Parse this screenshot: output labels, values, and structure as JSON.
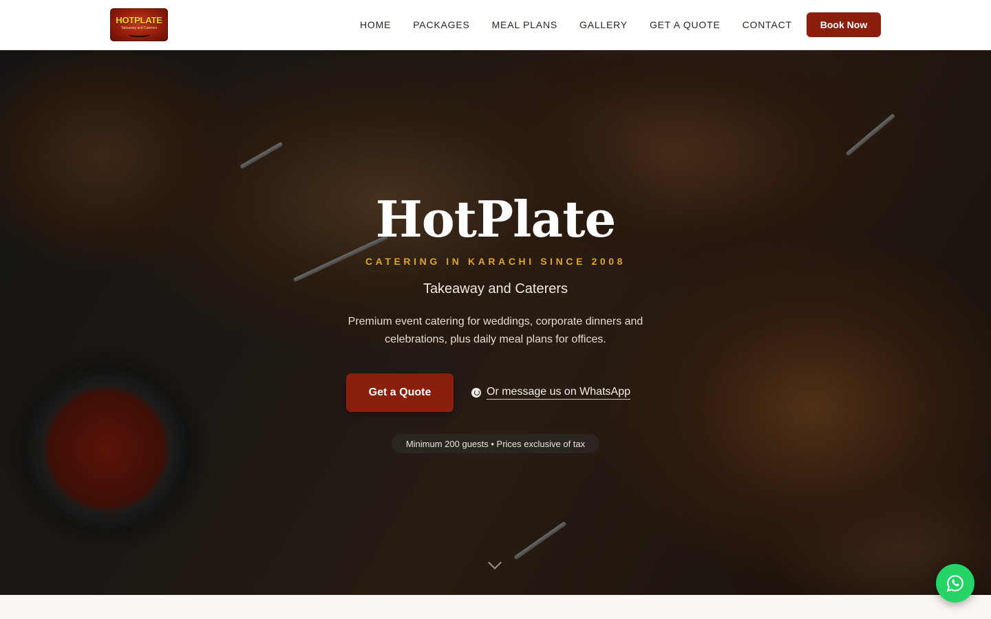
{
  "brand": {
    "logo_text": "HOTPLATE",
    "logo_subtext": "Takeaway and Caterers"
  },
  "nav": {
    "items": [
      {
        "label": "HOME"
      },
      {
        "label": "PACKAGES"
      },
      {
        "label": "MEAL PLANS"
      },
      {
        "label": "GALLERY"
      },
      {
        "label": "GET A QUOTE"
      },
      {
        "label": "CONTACT"
      }
    ],
    "book_label": "Book Now"
  },
  "hero": {
    "title": "HotPlate",
    "kicker": "CATERING IN KARACHI SINCE 2008",
    "tagline": "Takeaway and Caterers",
    "description": "Premium event catering for weddings, corporate dinners and celebrations, plus daily meal plans for offices.",
    "cta_quote": "Get a Quote",
    "cta_whatsapp": "Or message us on WhatsApp",
    "note": "Minimum 200 guests • Prices exclusive of tax"
  },
  "colors": {
    "accent": "#8a1f0e",
    "gold": "#e0a42a",
    "whatsapp": "#25d366"
  },
  "icons": {
    "whatsapp": "whatsapp-icon",
    "scroll": "chevron-down-icon"
  }
}
